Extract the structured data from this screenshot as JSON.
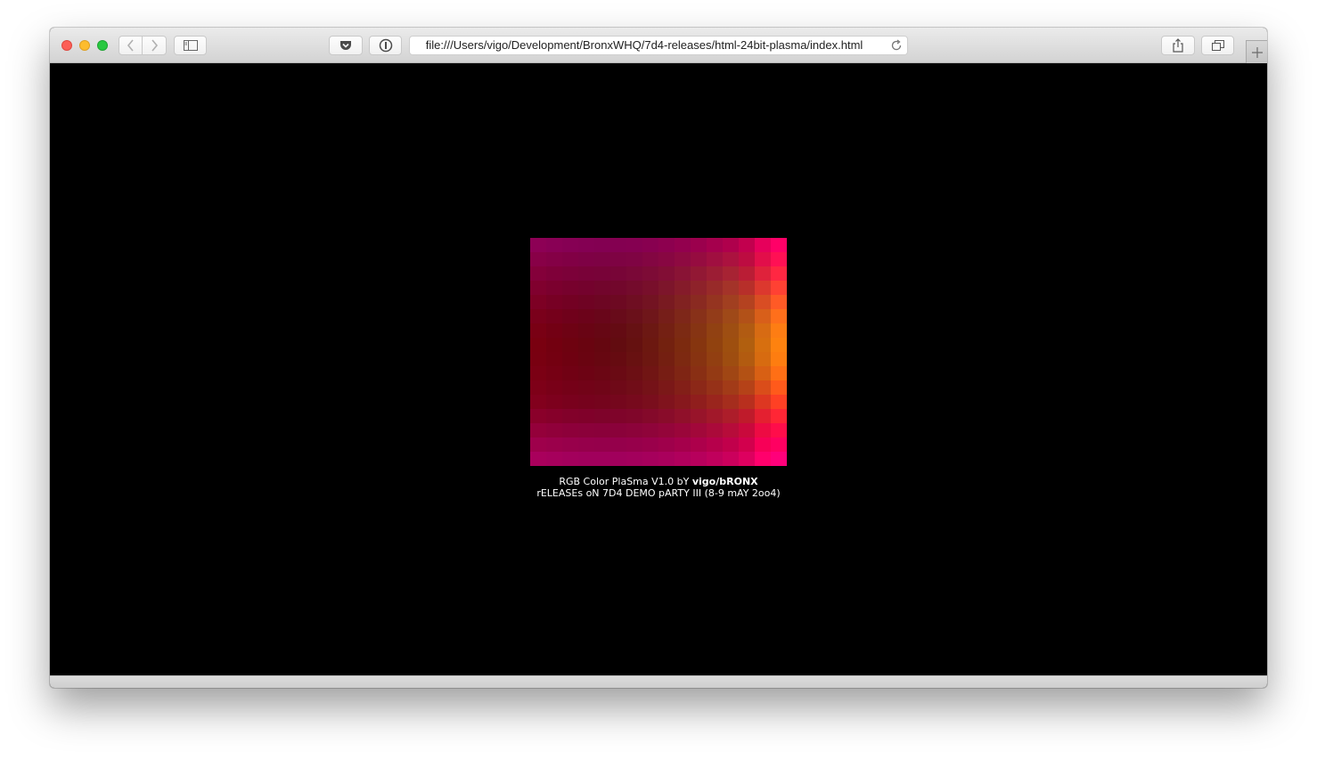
{
  "browser": {
    "url": "file:///Users/vigo/Development/BronxWHQ/7d4-releases/html-24bit-plasma/index.html",
    "icons": {
      "back": "chevron-left-icon",
      "forward": "chevron-right-icon",
      "sidebar": "sidebar-icon",
      "pocket": "pocket-icon",
      "reader": "info-icon",
      "reload": "reload-icon",
      "share": "share-icon",
      "tabs": "tabs-overview-icon",
      "new_tab": "plus-icon"
    }
  },
  "page": {
    "caption_line1_prefix": "RGB Color PlaSma V1.0 bY ",
    "caption_line1_author": "vigo/bRONX",
    "caption_line2": "rELEASEs oN 7D4 DEMO pARTY III (8-9 mAY 2oo4)"
  },
  "plasma": {
    "cols": 16,
    "rows": 16,
    "corner_colors": {
      "top_left": "#870a4c",
      "top_right": "#c0084c",
      "bottom_left": "#930a4a",
      "bottom_right": "#c8004c",
      "center_left": "#5c0005",
      "right_mid": "#8c6a00",
      "center_dark": "#3a0818"
    }
  }
}
